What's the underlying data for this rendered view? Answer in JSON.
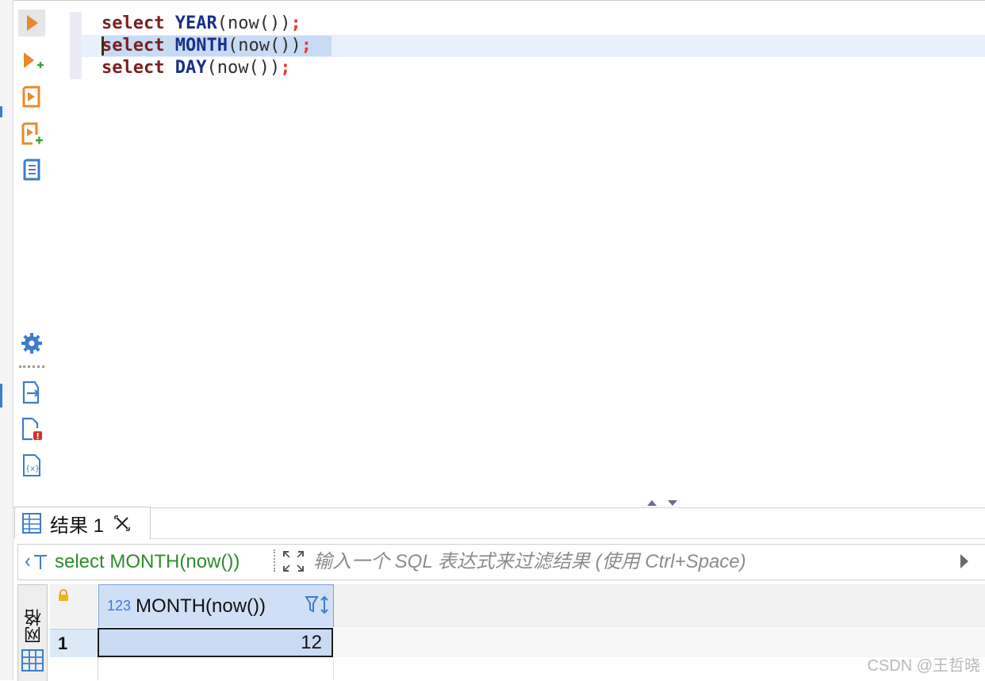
{
  "editor": {
    "lines": [
      {
        "kw": "select",
        "fn": "YEAR",
        "args": "(now())",
        "semi": ";"
      },
      {
        "kw": "select",
        "fn": "MONTH",
        "args": "(now())",
        "semi": ";"
      },
      {
        "kw": "select",
        "fn": "DAY",
        "args": "(now())",
        "semi": ";"
      }
    ]
  },
  "toolbar_icons": [
    "execute-statement-icon",
    "execute-in-new-tab-icon",
    "execute-script-icon",
    "execute-script-new-tab-icon",
    "explain-plan-icon",
    "settings-gear-icon",
    "export-icon",
    "problems-icon",
    "variables-icon"
  ],
  "results": {
    "tab_label": "结果 1",
    "filter": {
      "query_label": "select MONTH(now())",
      "placeholder": "输入一个 SQL 表达式来过滤结果 (使用 Ctrl+Space)"
    },
    "side_tab_label": "网格",
    "columns": [
      {
        "type": "123",
        "name": "MONTH(now())"
      }
    ],
    "rows": [
      {
        "num": "1",
        "value": "12"
      }
    ]
  },
  "watermark": "CSDN @王哲晓",
  "colors": {
    "keyword": "#7a1f1f",
    "function": "#1a2f8a",
    "semicolon": "#e53b2e",
    "filter_text": "#2e8b2e",
    "accent": "#3d7cc9"
  }
}
